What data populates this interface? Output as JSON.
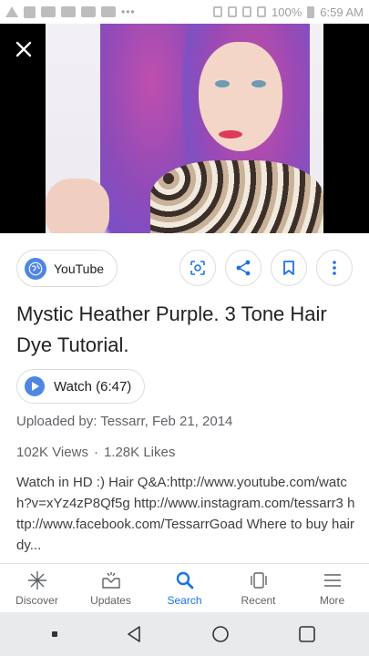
{
  "status_bar": {
    "time": "6:59 AM",
    "battery": "100%",
    "dots": "•••"
  },
  "card": {
    "source_label": "YouTube",
    "title": "Mystic Heather Purple. 3 Tone Hair Dye Tutorial.",
    "watch_label": "Watch (6:47)",
    "uploaded": "Uploaded by: Tessarr, Feb 21, 2014",
    "views": "102K Views",
    "separator": "·",
    "likes": "1.28K Likes",
    "description": "Watch in HD :) Hair Q&A:http://www.youtube.com/watch?v=xYz4zP8Qf5g http://www.instagram.com/tessarr3 http://www.facebook.com/TessarrGoad Where to buy hair dy..."
  },
  "bottom_nav": {
    "items": [
      {
        "label": "Discover",
        "icon": "asterisk-icon"
      },
      {
        "label": "Updates",
        "icon": "updates-tray-icon"
      },
      {
        "label": "Search",
        "icon": "search-icon",
        "active": true
      },
      {
        "label": "Recent",
        "icon": "recent-cards-icon"
      },
      {
        "label": "More",
        "icon": "menu-icon"
      }
    ]
  },
  "colors": {
    "accent": "#1a73e8",
    "chip_blue": "#4f86e4",
    "text_primary": "#202124",
    "text_secondary": "#5f6368"
  }
}
